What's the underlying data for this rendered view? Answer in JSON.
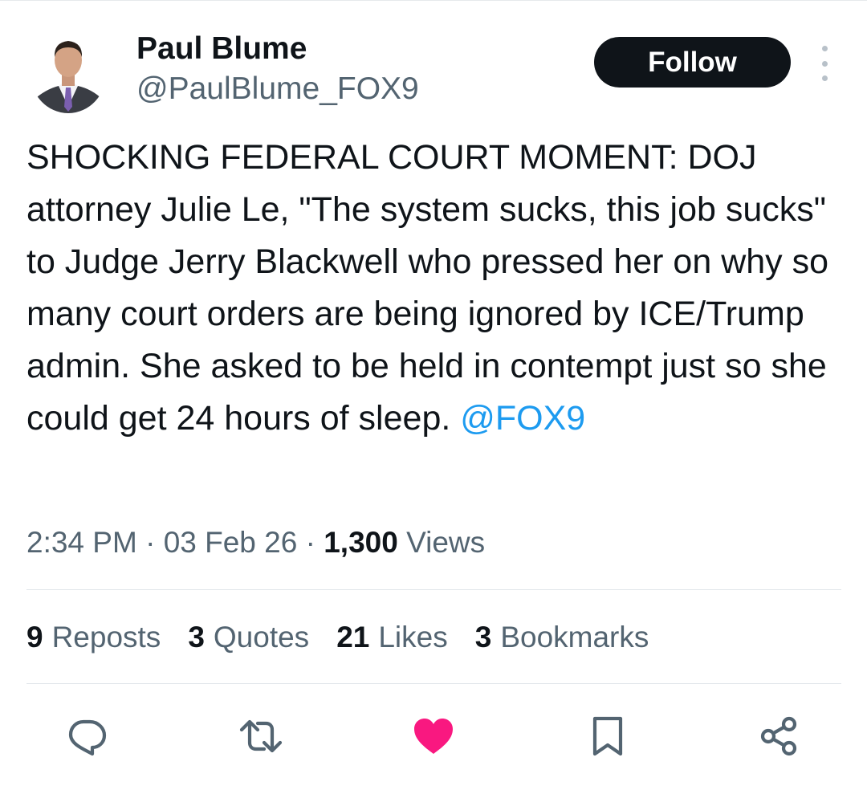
{
  "author": {
    "display_name": "Paul Blume",
    "handle": "@PaulBlume_FOX9"
  },
  "follow_label": "Follow",
  "tweet": {
    "text": "SHOCKING FEDERAL COURT MOMENT: DOJ attorney Julie Le, \"The system sucks, this job sucks\" to Judge Jerry Blackwell who pressed her on why so many court orders are being ignored by ICE/Trump admin. She asked to be held in contempt just so she could get 24 hours of sleep. ",
    "mention": "@FOX9"
  },
  "meta": {
    "time": "2:34 PM",
    "separator": "·",
    "date": "03 Feb 26",
    "views_count": "1,300",
    "views_label": "Views"
  },
  "stats": [
    {
      "count": "9",
      "label": "Reposts"
    },
    {
      "count": "3",
      "label": "Quotes"
    },
    {
      "count": "21",
      "label": "Likes"
    },
    {
      "count": "3",
      "label": "Bookmarks"
    }
  ],
  "actions": {
    "reply_icon": "reply-icon",
    "repost_icon": "repost-icon",
    "like_icon": "heart-icon",
    "bookmark_icon": "bookmark-icon",
    "share_icon": "share-icon"
  },
  "colors": {
    "text": "#0f1419",
    "secondary": "#536471",
    "link": "#1d9bf0",
    "like_active": "#f91880",
    "follow_bg": "#0f1419"
  }
}
